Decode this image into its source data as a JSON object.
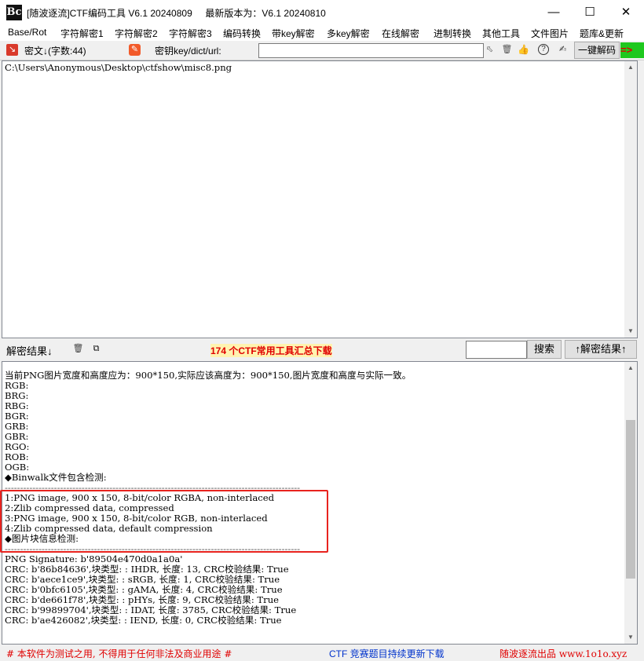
{
  "window": {
    "app_icon": "Bc",
    "title": "[随波逐流]CTF编码工具 V6.1 20240809     最新版本为：V6.1 20240810",
    "controls": [
      "minimize-icon",
      "maximize-icon",
      "close-icon"
    ]
  },
  "menu": [
    "Base/Rot",
    "字符解密1",
    "字符解密2",
    "字符解密3",
    "编码转换",
    "带key解密",
    "多key解密",
    "在线解密",
    "进制转换",
    "其他工具",
    "文件图片",
    "题库&更新"
  ],
  "toolbar": {
    "cipher_label": "密文↓(字数:44)",
    "key_label": "密钥key/dict/url:",
    "key_value": "",
    "decode_button": "一键解码",
    "arrow_label": "=>",
    "icons": [
      "exit-arrow-icon",
      "eraser-icon",
      "cursor-select-icon",
      "trash-icon",
      "thumbs-up-icon",
      "help-icon",
      "edit-icon"
    ]
  },
  "input_text": "C:\\Users\\Anonymous\\Desktop\\ctfshow\\misc8.png",
  "result_bar": {
    "label": "解密结果↓",
    "promo": "174 个CTF常用工具汇总下载",
    "search_value": "",
    "search_button": "搜索",
    "up_button": "↑解密结果↑"
  },
  "output_lines": [
    "当前PNG图片宽度和高度应为：900*150,实际应该高度为：900*150,图片宽度和高度与实际一致。",
    "RGB:",
    "BRG:",
    "RBG:",
    "BGR:",
    "GRB:",
    "GBR:",
    "RGO:",
    "ROB:",
    "OGB:",
    "",
    "◆Binwalk文件包含检测:",
    "------------------------------------------------------------------------------------------------",
    "1:PNG image, 900 x 150, 8-bit/color RGBA, non-interlaced",
    "2:Zlib compressed data, compressed",
    "3:PNG image, 900 x 150, 8-bit/color RGB, non-interlaced",
    "4:Zlib compressed data, default compression",
    "",
    "◆图片块信息检测:",
    "------------------------------------------------------------------------------------------------",
    "PNG Signature: b'89504e470d0a1a0a'",
    "CRC: b'86b84636',块类型: : IHDR, 长度: 13, CRC校验结果: True",
    "CRC: b'aece1ce9',块类型: : sRGB, 长度: 1, CRC校验结果: True",
    "CRC: b'0bfc6105',块类型: : gAMA, 长度: 4, CRC校验结果: True",
    "CRC: b'de661f78',块类型: : pHYs, 长度: 9, CRC校验结果: True",
    "CRC: b'99899704',块类型: : IDAT, 长度: 3785, CRC校验结果: True",
    "CRC: b'ae426082',块类型: : IEND, 长度: 0, CRC校验结果: True"
  ],
  "footer": {
    "left": "# 本软件为测试之用, 不得用于任何非法及商业用途 #",
    "center": "CTF 竞赛题目持续更新下载",
    "right": "随波逐流出品 www.1o1o.xyz"
  },
  "colors": {
    "highlight_box": "#e8231e",
    "footer_red": "#e00000",
    "footer_blue": "#0033cc",
    "promo_red": "#e00000"
  }
}
